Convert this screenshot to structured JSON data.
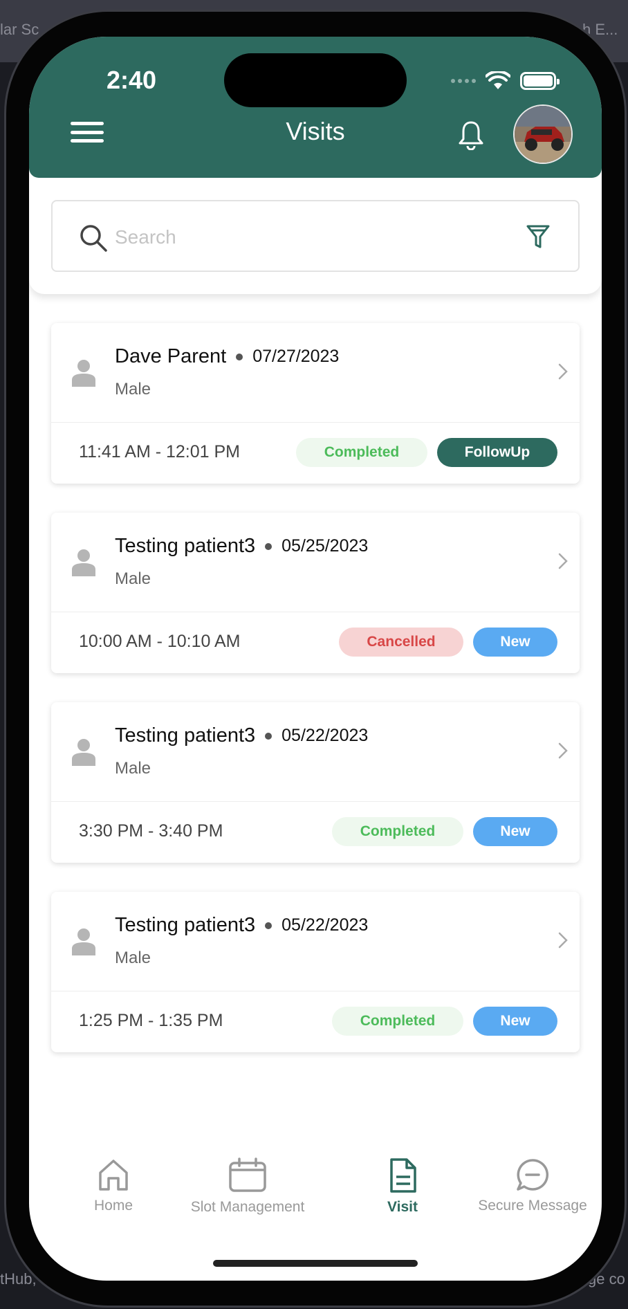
{
  "background": {
    "left_text": "lar Sc",
    "right_text": "h E...",
    "bottom_left_text": "tHub,",
    "bottom_right_text": "ge co"
  },
  "status_bar": {
    "time": "2:40"
  },
  "header": {
    "title": "Visits",
    "menu_icon": "menu-icon",
    "bell_icon": "bell-icon",
    "avatar": "avatar-red-truck"
  },
  "search": {
    "placeholder": "Search",
    "value": "",
    "search_icon": "search-icon",
    "filter_icon": "filter-icon"
  },
  "visits": [
    {
      "patient_name": "Dave Parent",
      "date": "07/27/2023",
      "gender": "Male",
      "time_range": "11:41 AM - 12:01 PM",
      "status": "Completed",
      "visit_type": "FollowUp"
    },
    {
      "patient_name": "Testing patient3",
      "date": "05/25/2023",
      "gender": "Male",
      "time_range": "10:00 AM - 10:10 AM",
      "status": "Cancelled",
      "visit_type": "New"
    },
    {
      "patient_name": "Testing patient3",
      "date": "05/22/2023",
      "gender": "Male",
      "time_range": "3:30 PM - 3:40 PM",
      "status": "Completed",
      "visit_type": "New"
    },
    {
      "patient_name": "Testing patient3",
      "date": "05/22/2023",
      "gender": "Male",
      "time_range": "1:25 PM - 1:35 PM",
      "status": "Completed",
      "visit_type": "New"
    }
  ],
  "tabs": [
    {
      "label": "Home",
      "icon": "home-icon",
      "active": false
    },
    {
      "label": "Slot Management",
      "icon": "calendar-icon",
      "active": false
    },
    {
      "label": "Visit",
      "icon": "document-icon",
      "active": true
    },
    {
      "label": "Secure Message",
      "icon": "chat-icon",
      "active": false
    }
  ],
  "colors": {
    "primary": "#2d6a5f",
    "completed_text": "#4cbb5a",
    "cancelled_text": "#d84747",
    "new_badge": "#5aaaf2",
    "inactive_tab": "#999999"
  }
}
